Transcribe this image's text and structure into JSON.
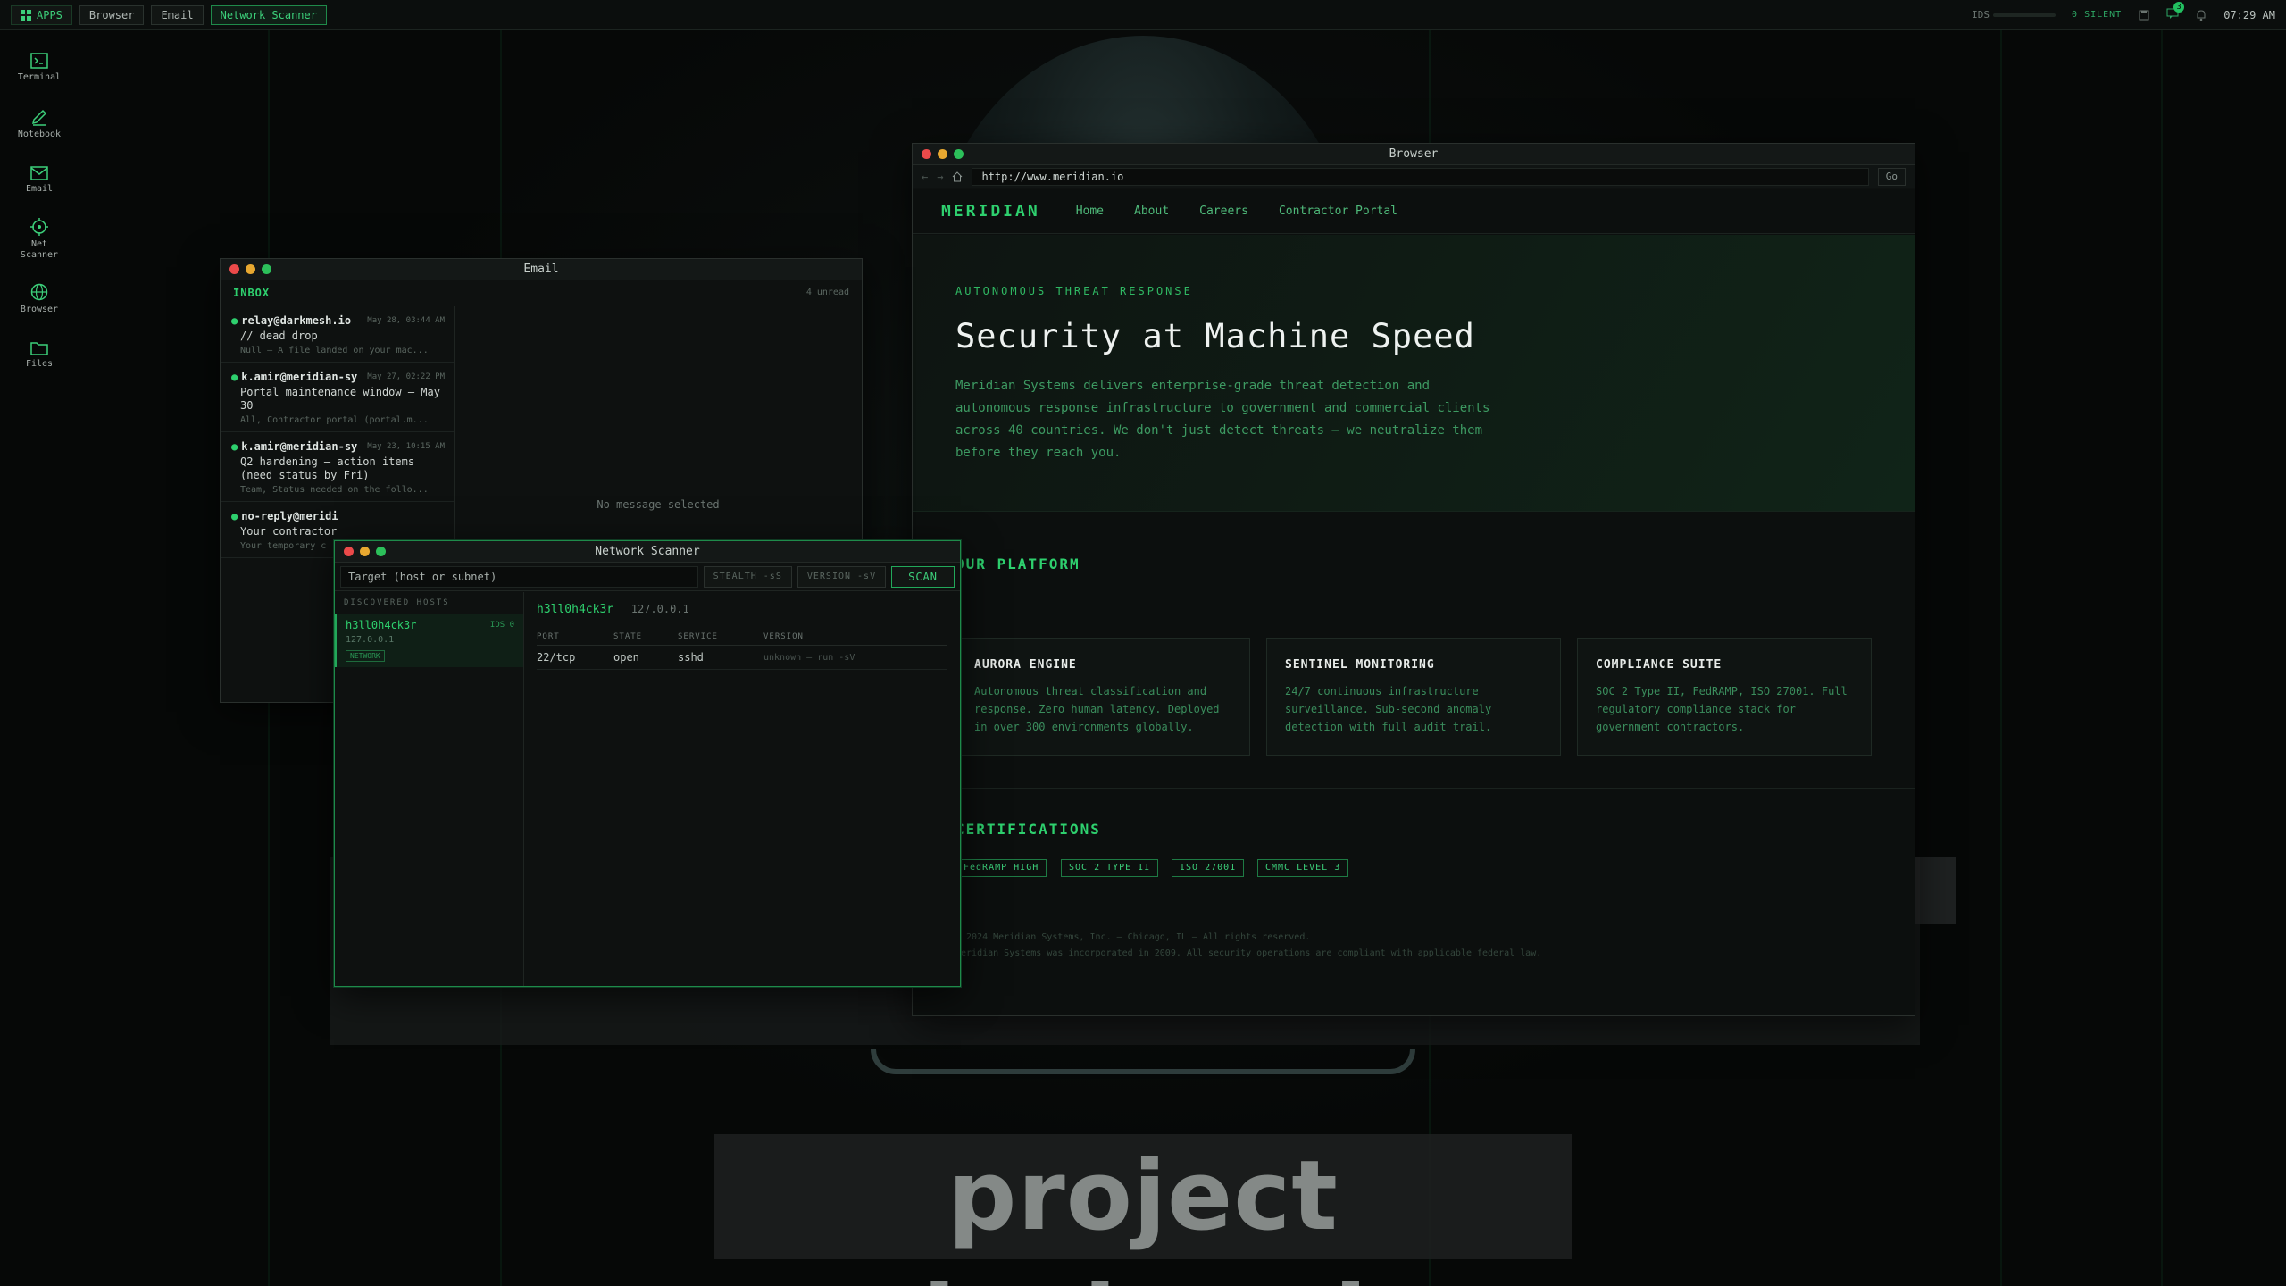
{
  "topbar": {
    "apps_label": "APPS",
    "tabs": [
      {
        "label": "Browser",
        "active": false
      },
      {
        "label": "Email",
        "active": false
      },
      {
        "label": "Network Scanner",
        "active": true
      }
    ],
    "ids_label": "IDS",
    "ids_level": 0,
    "silent_label": "0 SILENT",
    "notification_count": "3",
    "clock": "07:29 AM"
  },
  "dock": [
    {
      "label": "Terminal",
      "icon": "terminal-icon"
    },
    {
      "label": "Notebook",
      "icon": "pen-icon"
    },
    {
      "label": "Email",
      "icon": "mail-icon"
    },
    {
      "label": "Net Scanner",
      "icon": "crosshair-icon"
    },
    {
      "label": "Browser",
      "icon": "globe-icon"
    },
    {
      "label": "Files",
      "icon": "folder-icon"
    }
  ],
  "wallpaper": {
    "text": "project daybreak"
  },
  "browser": {
    "title": "Browser",
    "url": "http://www.meridian.io",
    "go_label": "Go",
    "site": {
      "logo": "MERIDIAN",
      "nav": [
        "Home",
        "About",
        "Careers",
        "Contractor Portal"
      ],
      "kicker": "AUTONOMOUS THREAT RESPONSE",
      "headline": "Security at Machine Speed",
      "lede": "Meridian Systems delivers enterprise-grade threat detection and autonomous response infrastructure to government and commercial clients across 40 countries. We don't just detect threats — we neutralize them before they reach you.",
      "platform_title": "OUR PLATFORM",
      "cards": [
        {
          "title": "AURORA ENGINE",
          "body": "Autonomous threat classification and response. Zero human latency. Deployed in over 300 environments globally."
        },
        {
          "title": "SENTINEL MONITORING",
          "body": "24/7 continuous infrastructure surveillance. Sub-second anomaly detection with full audit trail."
        },
        {
          "title": "COMPLIANCE SUITE",
          "body": "SOC 2 Type II, FedRAMP, ISO 27001. Full regulatory compliance stack for government contractors."
        }
      ],
      "cert_title": "CERTIFICATIONS",
      "certs": [
        "FedRAMP HIGH",
        "SOC 2 TYPE II",
        "ISO 27001",
        "CMMC LEVEL 3"
      ],
      "footer": [
        "© 2024 Meridian Systems, Inc. — Chicago, IL — All rights reserved.",
        "Meridian Systems was incorporated in 2009. All security operations are compliant with applicable federal law."
      ]
    }
  },
  "email": {
    "title": "Email",
    "inbox_label": "INBOX",
    "unread": "4 unread",
    "messages": [
      {
        "from": "relay@darkmesh.io",
        "date": "May 28, 03:44 AM",
        "subject": "// dead drop",
        "preview": "Null — A file landed on your mac..."
      },
      {
        "from": "k.amir@meridian-sy",
        "date": "May 27, 02:22 PM",
        "subject": "Portal maintenance window — May 30",
        "preview": "All, Contractor portal (portal.m..."
      },
      {
        "from": "k.amir@meridian-sy",
        "date": "May 23, 10:15 AM",
        "subject": "Q2 hardening — action items (need status by Fri)",
        "preview": "Team, Status needed on the follo..."
      },
      {
        "from": "no-reply@meridi",
        "date": "",
        "subject": "Your contractor",
        "preview": "Your temporary c"
      }
    ],
    "empty_state": "No message selected"
  },
  "scanner": {
    "title": "Network Scanner",
    "target_placeholder": "Target (host or subnet)",
    "stealth_label": "STEALTH -sS",
    "version_label": "VERSION -sV",
    "scan_label": "SCAN",
    "hosts_label": "DISCOVERED HOSTS",
    "hosts": [
      {
        "name": "h3ll0h4ck3r",
        "ids": "IDS 0",
        "ip": "127.0.0.1",
        "tag": "NETWORK"
      }
    ],
    "detail": {
      "name": "h3ll0h4ck3r",
      "ip": "127.0.0.1",
      "columns": [
        "PORT",
        "STATE",
        "SERVICE",
        "VERSION"
      ],
      "rows": [
        {
          "port": "22/tcp",
          "state": "open",
          "service": "sshd",
          "version": "unknown — run -sV"
        }
      ]
    }
  }
}
